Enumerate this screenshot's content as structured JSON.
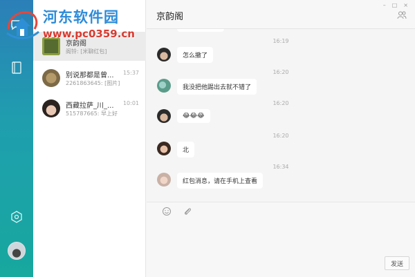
{
  "watermark": {
    "title": "河东软件园",
    "url": "www.pc0359.cn"
  },
  "sidebar": {
    "icons": [
      "chat-icon",
      "contacts-icon",
      "settings-icon"
    ],
    "accent": "#1ea3a6"
  },
  "conversations": [
    {
      "name": "京韵阁",
      "preview": "阁铃: [米聊红包]",
      "time": "",
      "active": true
    },
    {
      "name": "别说那都是曾...",
      "preview": "2261863645: [图片]",
      "time": "15:37",
      "active": false
    },
    {
      "name": "西藏拉萨_川_...",
      "preview": "515787665: 早上好",
      "time": "10:01",
      "active": false
    }
  ],
  "chat": {
    "title": "京韵阁",
    "window_buttons": [
      "–",
      "□",
      "×"
    ],
    "messages": [
      {
        "time": "16:19",
        "text": "怎么撤了"
      },
      {
        "time": "16:20",
        "text": "我没把他踢出去就不错了"
      },
      {
        "time": "16:20",
        "text": "😂😂😂"
      },
      {
        "time": "16:20",
        "text": "北"
      },
      {
        "time": "16:34",
        "text": "红包消息，请在手机上查看"
      }
    ],
    "send_label": "发送"
  }
}
